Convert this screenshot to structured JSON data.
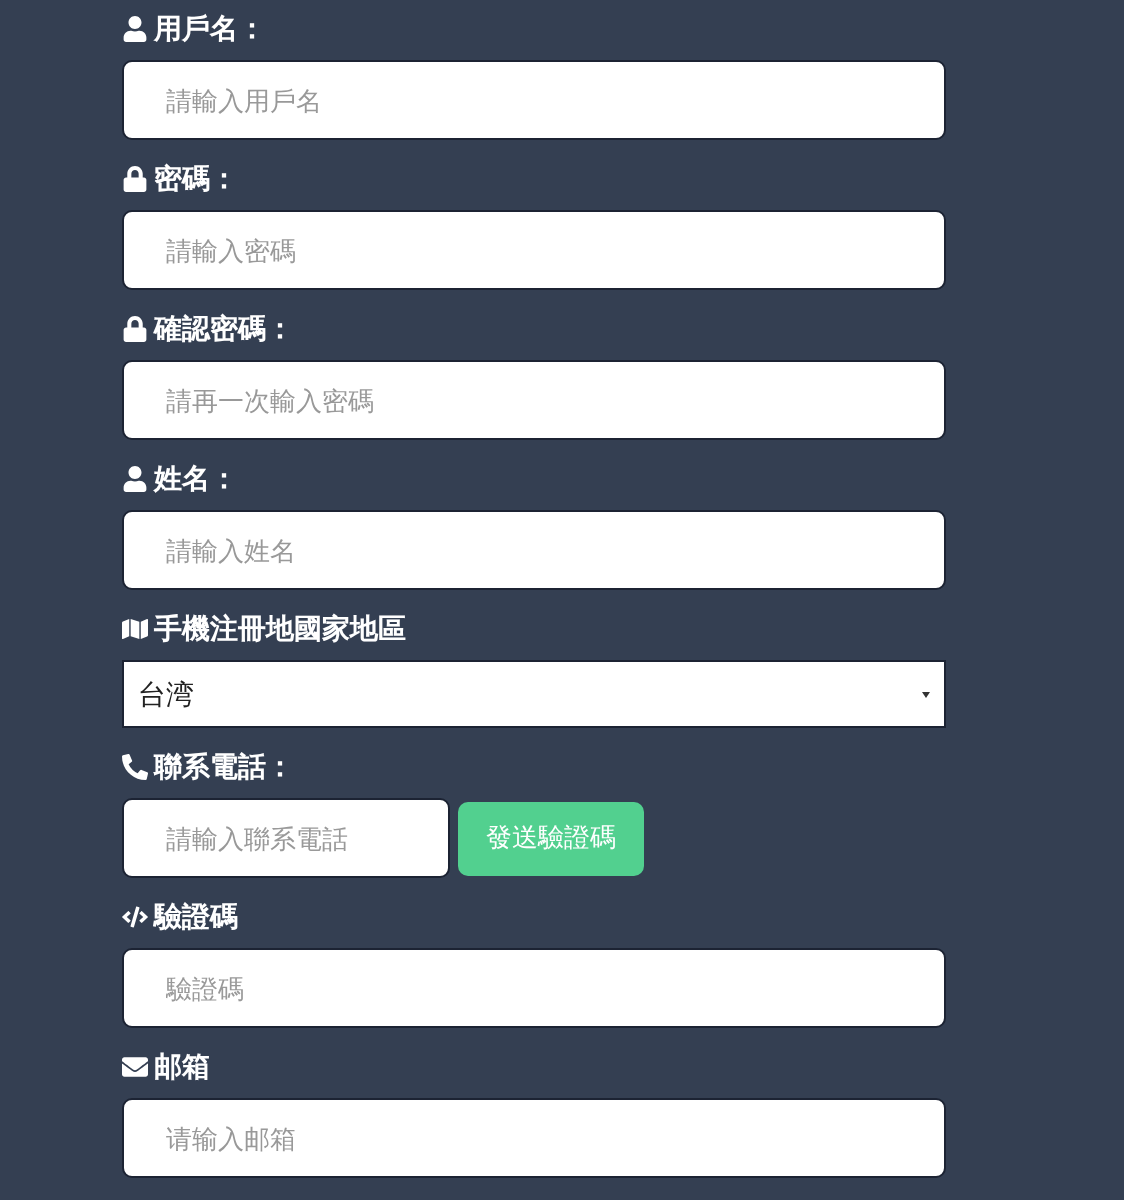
{
  "fields": [
    {
      "kind": "text",
      "label": "用戶名：",
      "placeholder": "請輸入用戶名"
    },
    {
      "kind": "text",
      "label": "密碼：",
      "placeholder": "請輸入密碼"
    },
    {
      "kind": "text",
      "label": "確認密碼：",
      "placeholder": "請再一次輸入密碼"
    },
    {
      "kind": "text",
      "label": "姓名：",
      "placeholder": "請輸入姓名"
    },
    {
      "kind": "select",
      "label": "手機注冊地國家地區",
      "value": "台湾"
    },
    {
      "kind": "phone",
      "label": "聯系電話：",
      "placeholder": "請輸入聯系電話",
      "button": "發送驗證碼"
    },
    {
      "kind": "text",
      "label": "驗證碼",
      "placeholder": "驗證碼"
    },
    {
      "kind": "text",
      "label": "邮箱",
      "placeholder": "请输入邮箱"
    }
  ]
}
